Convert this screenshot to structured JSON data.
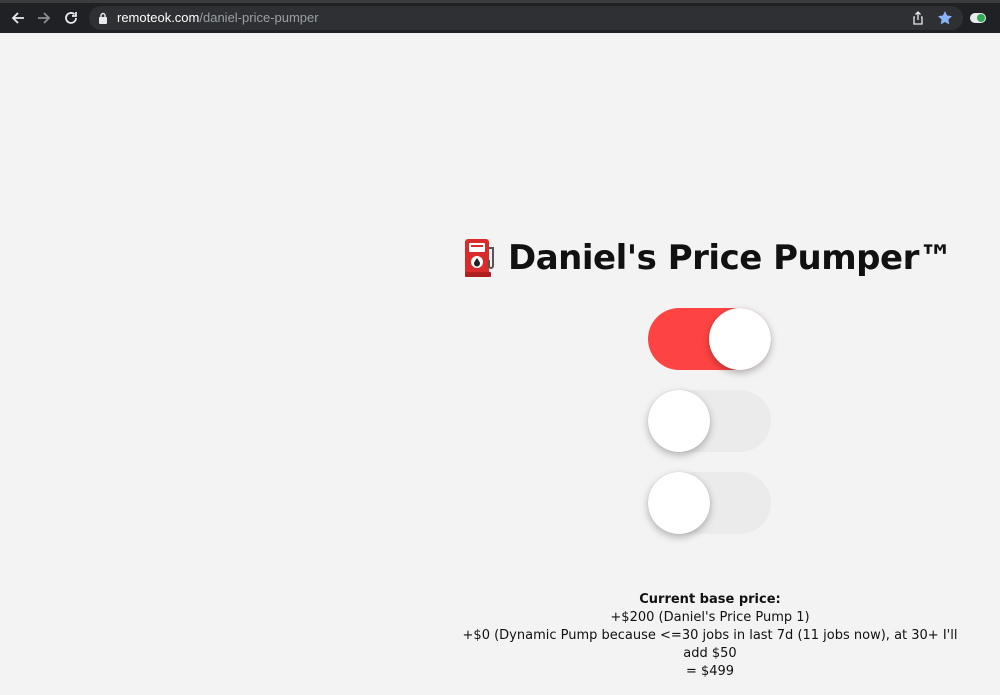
{
  "browser": {
    "url_host": "remoteok.com",
    "url_path": "/daniel-price-pumper"
  },
  "page": {
    "title": "Daniel's Price Pumper™",
    "title_icon": "fuel-pump-icon"
  },
  "toggles": [
    {
      "state": "on",
      "color": "#fe4442"
    },
    {
      "state": "off",
      "color": "#ebebeb"
    },
    {
      "state": "off",
      "color": "#ebebeb"
    }
  ],
  "price": {
    "heading": "Current base price:",
    "line1": "+$200 (Daniel's Price Pump 1)",
    "line2": "+$0 (Dynamic Pump because <=30 jobs in last 7d (11 jobs now), at 30+ I'll add $50",
    "total": "= $499"
  },
  "colors": {
    "accent": "#fe4442",
    "background": "#f4f3f4",
    "star": "#8ab4f8"
  }
}
